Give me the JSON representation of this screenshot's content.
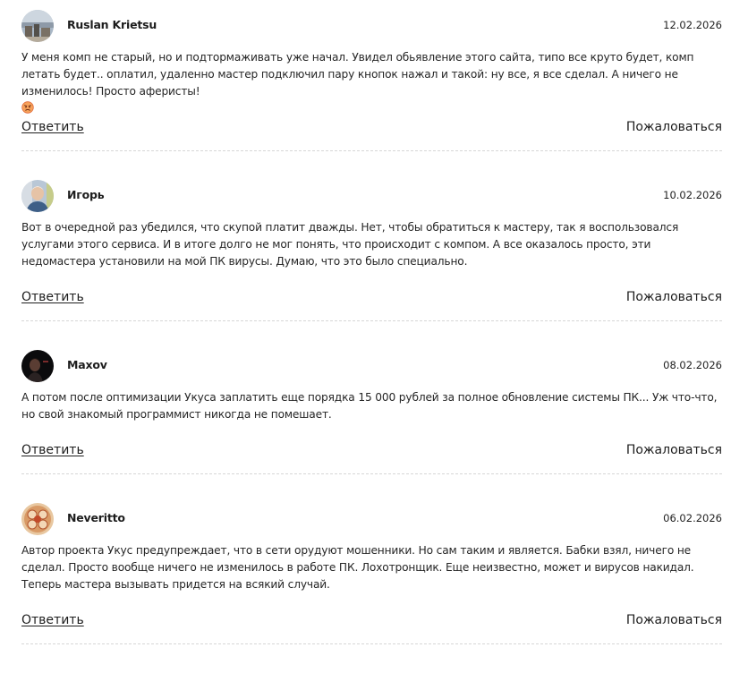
{
  "reviews": [
    {
      "author": "Ruslan Krietsu",
      "date": "12.02.2026",
      "text": "У меня комп не старый, но и подтормаживать уже начал. Увидел обьявление этого сайта, типо все круто будет, комп летать будет.. оплатил, удаленно мастер подключил пару кнопок нажал и такой: ну все, я все сделал. А ничего не изменилось! Просто аферисты!",
      "emoji": "angry-face-emoji",
      "reply_label": "Ответить",
      "report_label": "Пожаловаться"
    },
    {
      "author": "Игорь",
      "date": "10.02.2026",
      "text": "Вот в очередной раз убедился, что скупой платит дважды. Нет, чтобы обратиться к мастеру, так я воспользовался услугами этого сервиса. И в итоге долго не мог понять, что происходит с компом. А все оказалось просто, эти недомастера установили на мой ПК вирусы. Думаю, что это было специально.",
      "reply_label": "Ответить",
      "report_label": "Пожаловаться"
    },
    {
      "author": "Maxov",
      "date": "08.02.2026",
      "text": "А потом после оптимизации Укуса заплатить еще порядка 15 000 рублей за полное обновление системы ПК... Уж что-что, но свой знакомый программист никогда не помешает.",
      "reply_label": "Ответить",
      "report_label": "Пожаловаться"
    },
    {
      "author": "Neveritto",
      "date": "06.02.2026",
      "text": "Автор проекта Укус предупреждает, что в сети орудуют мошенники. Но сам таким и является. Бабки взял, ничего не сделал. Просто вообще ничего не изменилось в работе ПК. Лохотронщик. Еще неизвестно, может и вирусов накидал. Теперь мастера вызывать придется на всякий случай.",
      "reply_label": "Ответить",
      "report_label": "Пожаловаться"
    }
  ]
}
